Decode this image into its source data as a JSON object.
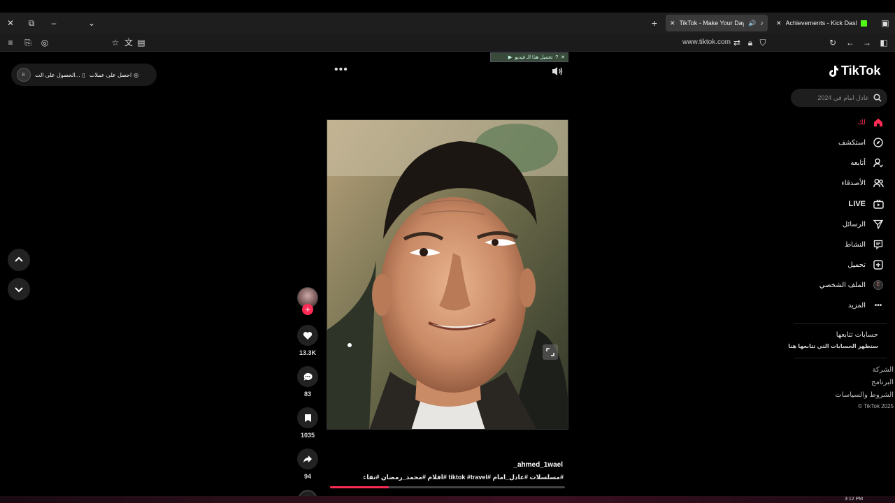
{
  "browser": {
    "tabs": [
      {
        "title": "TikTok - Make Your Day",
        "active": true
      },
      {
        "title": "Achievements - Kick Dashboard",
        "active": false
      }
    ],
    "url": "www.tiktok.com"
  },
  "promo": {
    "get_coins": "احصل على عملات",
    "get_app": "الحصول على الت..."
  },
  "overlay": {
    "download_video": "تحميل هذا الـ فيديو"
  },
  "video": {
    "likes": "13.3K",
    "comments": "83",
    "saves": "1035",
    "shares": "94",
    "username": "_ahmed_1wael",
    "hashtags": "#مسلسلات #عادل_امام #tiktok #travel #افلام #محمد_رمضان #تفاعلكم",
    "progress": 0.25
  },
  "sidebar": {
    "logo_text": "TikTok",
    "search_placeholder": "عادل امام في 2024",
    "items": {
      "home": "لك",
      "explore": "استكشف",
      "following": "أتابعه",
      "friends": "الأصدقاء",
      "live": "LIVE",
      "messages": "الرسائل",
      "activity": "النشاط",
      "upload": "تحميل",
      "profile": "الملف الشخصي",
      "more": "المزيد"
    },
    "following_accounts_title": "حسابات تتابعها",
    "following_accounts_desc": "ستظهر الحسابات التي تتابعها هنا",
    "footer": {
      "company": "الشركة",
      "program": "البرنامج",
      "terms": "الشروط والسياسات",
      "copyright": "© TikTok 2025"
    }
  },
  "taskbar": {
    "clock": "3:12 PM"
  },
  "colors": {
    "accent": "#fe2c55",
    "background": "#000000"
  }
}
